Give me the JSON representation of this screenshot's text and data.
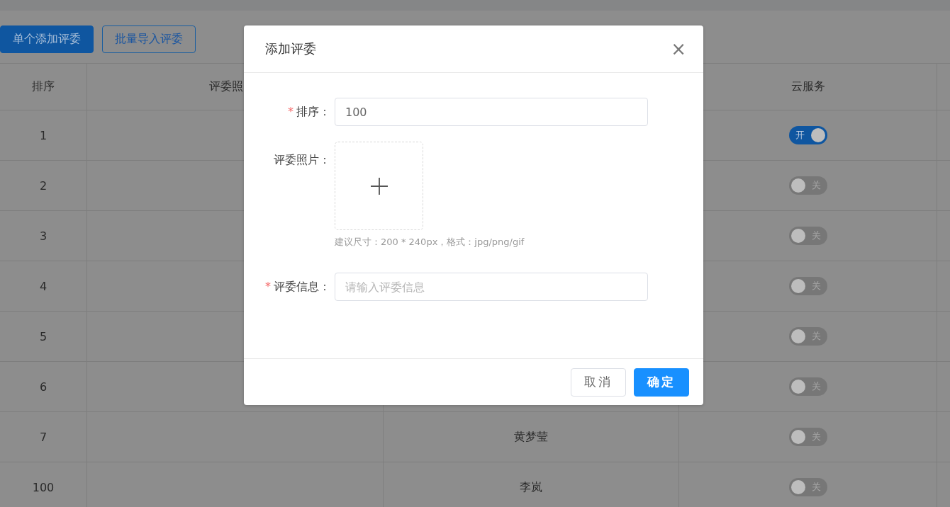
{
  "toolbar": {
    "buttons": [
      {
        "label": "单个添加评委",
        "primary": true
      },
      {
        "label": "批量导入评委",
        "primary": false
      }
    ]
  },
  "table": {
    "header": {
      "order": "排序",
      "photo": "评委照",
      "cloud_service": "云服务"
    },
    "rows": [
      {
        "order": "1",
        "cloud_service": {
          "on": true,
          "label": "开"
        }
      },
      {
        "order": "2",
        "cloud_service": {
          "on": false,
          "label": "关"
        }
      },
      {
        "order": "3",
        "cloud_service": {
          "on": false,
          "label": "关"
        }
      },
      {
        "order": "4",
        "cloud_service": {
          "on": false,
          "label": "关"
        }
      },
      {
        "order": "5",
        "cloud_service": {
          "on": false,
          "label": "关"
        }
      },
      {
        "order": "6",
        "cloud_service": {
          "on": false,
          "label": "关"
        }
      },
      {
        "order": "7",
        "name": "黄梦莹",
        "cloud_service": {
          "on": false,
          "label": "关"
        }
      },
      {
        "order": "100",
        "name": "李岚",
        "cloud_service": {
          "on": false,
          "label": "关"
        }
      }
    ]
  },
  "dialog": {
    "title": "添加评委",
    "close": "×",
    "fields": [
      {
        "kind": "input",
        "required_mark": "*",
        "label": "排序：",
        "value": "100"
      },
      {
        "kind": "upload",
        "label": "评委照片：",
        "hint": "建议尺寸：200 * 240px，格式：jpg/png/gif"
      },
      {
        "kind": "input",
        "required_mark": "*",
        "label": "评委信息：",
        "placeholder": "请输入评委信息"
      }
    ],
    "buttons": [
      {
        "label": "取消",
        "primary": false
      },
      {
        "label": "确定",
        "primary": true
      }
    ]
  }
}
